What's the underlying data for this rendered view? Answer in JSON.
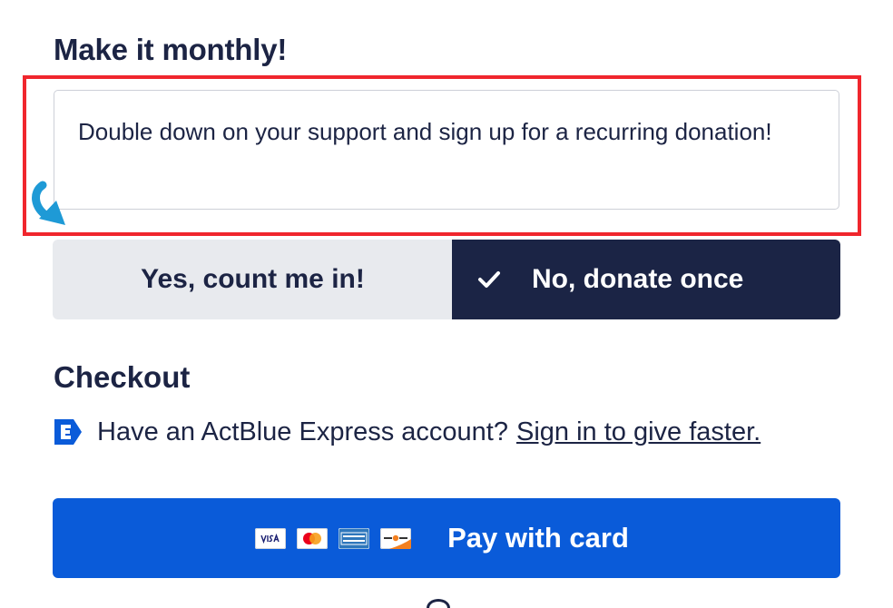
{
  "monthly": {
    "heading": "Make it monthly!",
    "note": "Double down on your support and sign up for a recurring donation!"
  },
  "frequency": {
    "yes_label": "Yes, count me in!",
    "no_label": "No, donate once",
    "selected": "no"
  },
  "checkout": {
    "heading": "Checkout",
    "express_text": "Have an ActBlue Express account?",
    "express_link": "Sign in to give faster."
  },
  "payment": {
    "button_label": "Pay with card",
    "cards": [
      "visa-icon",
      "mastercard-icon",
      "american-express-icon",
      "discover-icon"
    ]
  },
  "colors": {
    "navy": "#1b2445",
    "brand_blue": "#0a5bd9",
    "annotation_red": "#f0262d",
    "annotation_arrow": "#1e9ad6",
    "segment_unselected": "#e8eaee"
  }
}
